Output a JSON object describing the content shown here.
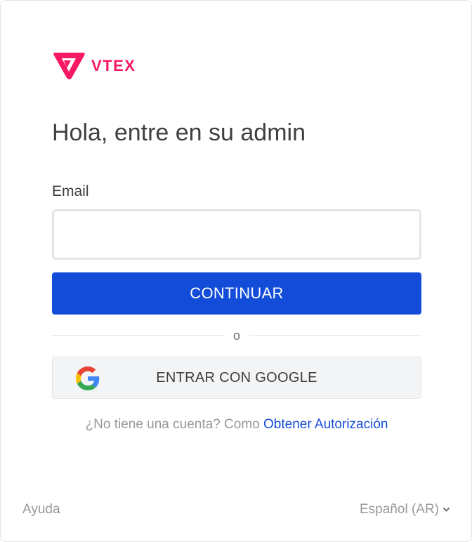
{
  "brand": {
    "name": "VTEX",
    "color": "#f71963"
  },
  "login": {
    "title": "Hola, entre en su admin",
    "email_label": "Email",
    "email_value": "",
    "email_placeholder": "",
    "continue_label": "CONTINUAR",
    "divider_text": "o",
    "google_label": "ENTRAR CON GOOGLE",
    "google_icon": "google-g-icon",
    "signup_prompt": "¿No tiene una cuenta? Como",
    "signup_link": "Obtener Autorización"
  },
  "footer": {
    "help_label": "Ayuda",
    "language_label": "Español (AR)",
    "language_icon": "chevron-down-icon"
  },
  "colors": {
    "primary": "#134cd8",
    "brand": "#f71963",
    "text": "#3f3f40",
    "muted": "#979899",
    "google_button_bg": "#f2f4f5"
  }
}
